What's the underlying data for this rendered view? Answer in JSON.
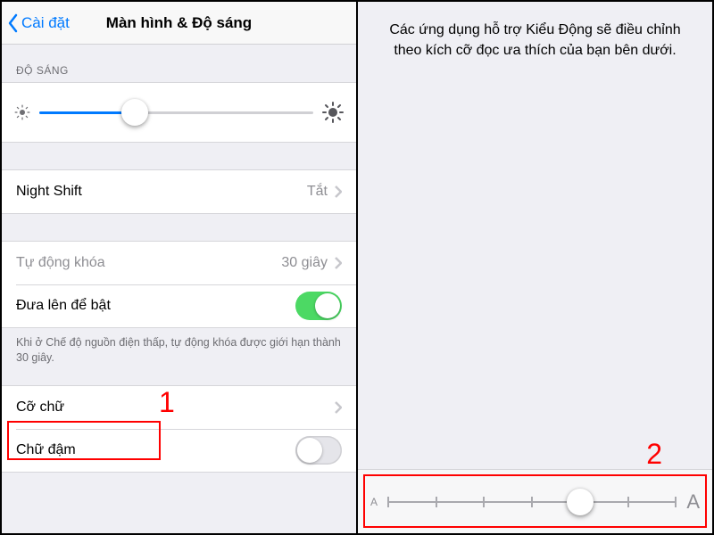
{
  "left": {
    "back_label": "Cài đặt",
    "title": "Màn hình & Độ sáng",
    "brightness_header": "ĐỘ SÁNG",
    "brightness_percent": 35,
    "rows": {
      "night_shift": {
        "label": "Night Shift",
        "value": "Tắt"
      },
      "auto_lock": {
        "label": "Tự động khóa",
        "value": "30 giây"
      },
      "raise_wake": {
        "label": "Đưa lên để bật",
        "on": true
      },
      "text_size": {
        "label": "Cỡ chữ"
      },
      "bold_text": {
        "label": "Chữ đậm",
        "on": false
      }
    },
    "footer_note": "Khi ở Chế độ nguồn điện thấp, tự động khóa được giới hạn thành 30 giây."
  },
  "right": {
    "description": "Các ứng dụng hỗ trợ Kiểu Động sẽ điều chỉnh theo kích cỡ đọc ưa thích của bạn bên dưới.",
    "textsize_steps": 7,
    "textsize_index": 4,
    "small_label": "A",
    "big_label": "A"
  },
  "callouts": {
    "one": "1",
    "two": "2"
  }
}
